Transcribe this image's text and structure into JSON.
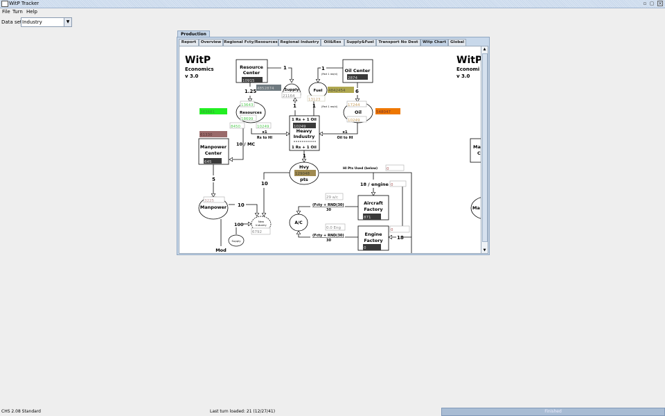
{
  "window": {
    "title": "WitP Tracker",
    "controls": [
      "minimize",
      "maximize",
      "close"
    ]
  },
  "menu": [
    "File",
    "Turn",
    "Help"
  ],
  "dataset": {
    "label": "Data set:",
    "value": "Industry"
  },
  "outer_tab": "Production",
  "tabs": [
    "Report",
    "Overview",
    "Regional Fcty/Resources",
    "Regional Industry",
    "Oil&Res",
    "Supply&Fuel",
    "Transport No Dest",
    "Witp Chart",
    "Global"
  ],
  "active_tab": "Witp Chart",
  "chart": {
    "title": "WitP",
    "subtitle": "Economics",
    "version": "v 3.0",
    "title_right": "WitP",
    "subtitle_right": "Economi",
    "version_right": "v 3.0",
    "resource_center": {
      "l1": "Resource",
      "l2": "Center",
      "value": "10915"
    },
    "res_stock": "4852874",
    "rc_to_res": "1.25",
    "rc_to_supply": "1",
    "supply": {
      "label": "Supply",
      "value": "21164"
    },
    "fuel": {
      "label": "Fuel",
      "value": "13123",
      "stock": "4842454"
    },
    "oil_center": {
      "label": "Oil Center",
      "value": "2874"
    },
    "oc_to_fuel": "1",
    "part_req": "(Part 1 req'd)",
    "oc_to_oil": "6",
    "resources": {
      "label": "Resources",
      "top": "13643",
      "mid": "18699",
      "left": "8450",
      "right": "10249"
    },
    "res_green": "383681",
    "oil": {
      "label": "Oil",
      "top": "17244",
      "bottom": "10249"
    },
    "oil_orange": "548047",
    "manpower_stock": "61330",
    "manpower_center": {
      "l1": "Manpower",
      "l2": "Center",
      "value": "645"
    },
    "mc_label": "10 / MC",
    "hi_in_left": "1",
    "hi_in_right": "1",
    "heavy_industry": {
      "top": "1 Rs + 1 Oil",
      "value": "10249",
      "l1": "Heavy",
      "l2": "Industry",
      "bottom": "1 Rs + 1 Oil"
    },
    "rs_to_hi": {
      "l1": "x1",
      "l2": "Rs to HI"
    },
    "oil_to_hi": {
      "l1": "x1",
      "l2": "Oil to HI"
    },
    "hi_to_hvy": "1",
    "hvy": {
      "l1": "Hvy",
      "value": "129048",
      "l2": "pts"
    },
    "hi_pts_used": {
      "label": "HI Pts Used (below)",
      "value": "0"
    },
    "mc_to_mp": "5",
    "hvy_to_ni": "10",
    "per_engine": {
      "label": "18 / engine",
      "value": "0"
    },
    "manpower": {
      "label": "Manpower",
      "value": "3225"
    },
    "mp_to_ni": "10",
    "new_industry": {
      "l1": "New",
      "l2": "Industry",
      "value": "6792"
    },
    "supply_to_ni": "100",
    "small_supply": "Supply",
    "ac_count": "29 a/c",
    "formula": "(Fcty + RND(30)",
    "formula_den": "30",
    "aircraft_factory": {
      "l1": "Aircraft",
      "l2": "Factory",
      "value": "871"
    },
    "ac": "A/C",
    "eng_count": "0.0 Eng",
    "engine_factory": {
      "l1": "Engine",
      "l2": "Factory",
      "value": "0"
    },
    "ef_box": "0",
    "ef_in": "18",
    "mod_cut": "Mod",
    "right_mc": {
      "l1": "Ma",
      "l2": "C"
    },
    "right_mp": "Ma"
  },
  "colors": {
    "green": "#22ee22",
    "orange": "#ee7700",
    "olive": "#b0a850",
    "brown": "#9a6a6a",
    "slate": "#6f7a80",
    "tan": "#a08a50",
    "dark": "#3a3a3a"
  },
  "status": {
    "left": "CHS 2.08 Standard",
    "center": "Last turn loaded: 21 (12/27/41)",
    "progress_label": "Finished",
    "progress": 100
  }
}
